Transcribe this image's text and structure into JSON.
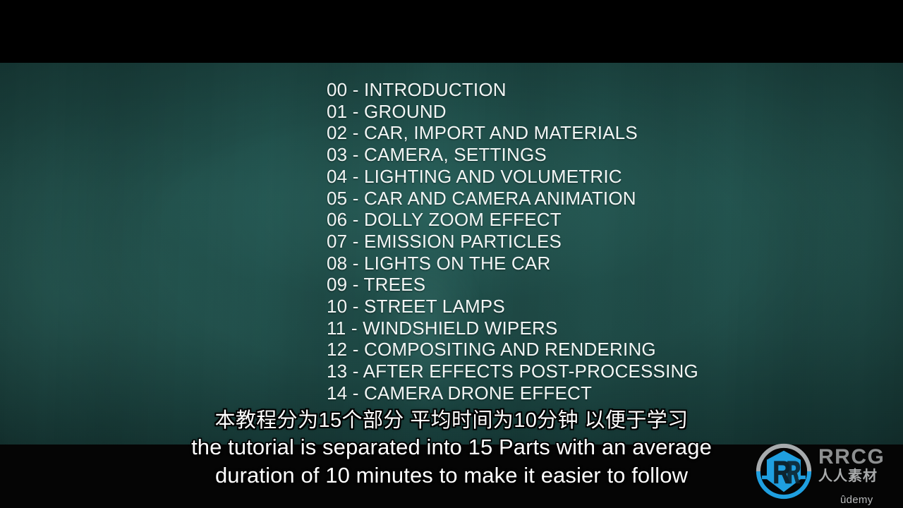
{
  "video": {
    "background_color": "#1e4a46",
    "letterbox_color": "#000000"
  },
  "chapter_list": {
    "items": [
      {
        "label": "00 - INTRODUCTION"
      },
      {
        "label": "01 - GROUND"
      },
      {
        "label": "02 - CAR, IMPORT AND MATERIALS"
      },
      {
        "label": "03 - CAMERA, SETTINGS"
      },
      {
        "label": "04 - LIGHTING AND VOLUMETRIC"
      },
      {
        "label": "05 - CAR AND CAMERA ANIMATION"
      },
      {
        "label": "06 - DOLLY ZOOM EFFECT"
      },
      {
        "label": "07 - EMISSION PARTICLES"
      },
      {
        "label": "08 - LIGHTS ON THE CAR"
      },
      {
        "label": "09 - TREES"
      },
      {
        "label": "10 - STREET LAMPS"
      },
      {
        "label": "11 - WINDSHIELD WIPERS"
      },
      {
        "label": "12 - COMPOSITING AND RENDERING"
      },
      {
        "label": "13 - AFTER EFFECTS POST-PROCESSING"
      },
      {
        "label": "14 - CAMERA DRONE EFFECT"
      }
    ]
  },
  "subtitles": {
    "chinese": "本教程分为15个部分 平均时间为10分钟 以便于学习",
    "english_line_1": "the tutorial is separated into 15 Parts with an average",
    "english_line_2": "duration of 10 minutes to make it easier to follow"
  },
  "watermark": {
    "brand": "RRCG",
    "brand_cn": "人人素材",
    "platform": "ûdemy",
    "logo_icon": "rrcg-shield-logo",
    "brand_color": "#1f9fe0",
    "text_color": "#8d8f90"
  }
}
